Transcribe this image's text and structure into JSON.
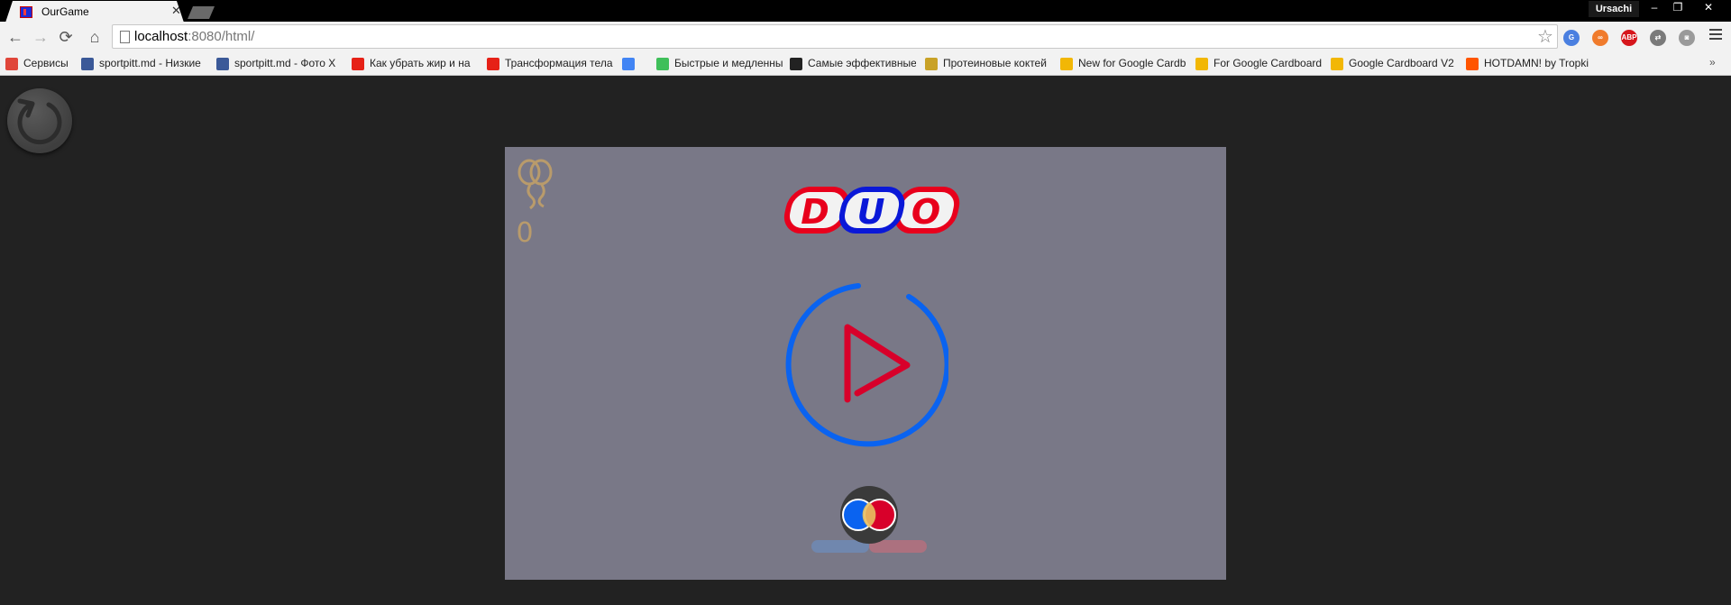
{
  "tab": {
    "title": "OurGame",
    "favicon": "game-favicon",
    "close_icon": "✕"
  },
  "window": {
    "user": "Ursachi",
    "minimize": "‒",
    "restore": "❐",
    "close": "✕"
  },
  "toolbar": {
    "back": "←",
    "forward": "→",
    "reload": "⟳",
    "home": "⌂",
    "url_host": "localhost",
    "url_rest": ":8080/html/",
    "star": "☆"
  },
  "extensions": [
    {
      "name": "google-translate-icon",
      "label": "G",
      "color": "#4a7fe0"
    },
    {
      "name": "infinity-icon",
      "label": "∞",
      "color": "#f07b2c"
    },
    {
      "name": "adblock-plus-icon",
      "label": "ABP",
      "color": "#d6161c"
    },
    {
      "name": "sync-extension-icon",
      "label": "⇄",
      "color": "#7a7a7a"
    },
    {
      "name": "camera-extension-icon",
      "label": "◙",
      "color": "#9a9a9a"
    }
  ],
  "bookmarks": [
    {
      "label": "Сервисы",
      "icon": "apps-icon",
      "color": "#e0463a"
    },
    {
      "label": "sportpitt.md - Низкие",
      "icon": "facebook-icon",
      "color": "#3b5998"
    },
    {
      "label": "sportpitt.md - Фото X",
      "icon": "facebook-icon",
      "color": "#3b5998"
    },
    {
      "label": "Как убрать жир и на",
      "icon": "youtube-icon",
      "color": "#e62117"
    },
    {
      "label": "Трансформация тела",
      "icon": "youtube-icon",
      "color": "#e62117"
    },
    {
      "label": "",
      "icon": "google-icon",
      "color": "#4285f4"
    },
    {
      "label": "Быстрые и медленны",
      "icon": "apple-icon",
      "color": "#3fbf5a"
    },
    {
      "label": "Самые эффективные",
      "icon": "runner-icon",
      "color": "#222222"
    },
    {
      "label": "Протеиновые коктей",
      "icon": "shake-icon",
      "color": "#c9a227"
    },
    {
      "label": "New for Google Cardb",
      "icon": "cardboard-icon",
      "color": "#f2b705"
    },
    {
      "label": "For Google Cardboard",
      "icon": "cardboard-icon",
      "color": "#f2b705"
    },
    {
      "label": "Google Cardboard V2",
      "icon": "cardboard-icon",
      "color": "#f2b705"
    },
    {
      "label": "HOTDAMN! by Tropki",
      "icon": "soundcloud-icon",
      "color": "#ff5500"
    }
  ],
  "bookmarks_overflow": "»",
  "game": {
    "balloon_count": "0",
    "logo_letters": [
      "D",
      "U",
      "O"
    ],
    "colors": {
      "red": "#e8001c",
      "blue": "#0a18d8",
      "play_ring": "#0a63f0",
      "play_triangle": "#d8002a",
      "balloon": "#b99b6b",
      "background": "#797887",
      "page_bg": "#222222"
    }
  }
}
